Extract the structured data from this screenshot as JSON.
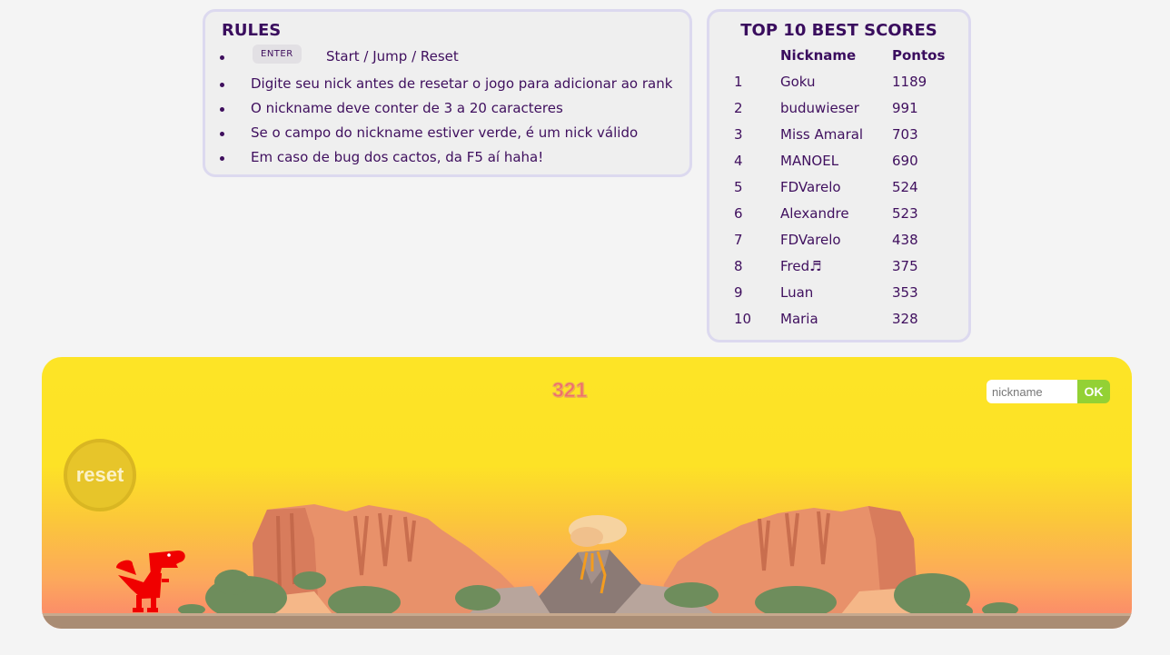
{
  "rules": {
    "title": "RULES",
    "enter_key": "ENTER",
    "items": [
      "Start / Jump / Reset",
      "Digite seu nick antes de resetar o jogo para adicionar ao rank",
      "O nickname deve conter de 3 a 20 caracteres",
      "Se o campo do nickname estiver verde, é um nick válido",
      "Em caso de bug dos cactos, da F5 aí haha!"
    ]
  },
  "scores": {
    "title": "TOP 10 BEST SCORES",
    "col_nickname": "Nickname",
    "col_points": "Pontos",
    "rows": [
      {
        "rank": "1",
        "nick": "Goku",
        "points": "1189"
      },
      {
        "rank": "2",
        "nick": "buduwieser",
        "points": "991"
      },
      {
        "rank": "3",
        "nick": "Miss Amaral",
        "points": "703"
      },
      {
        "rank": "4",
        "nick": "MANOEL",
        "points": "690"
      },
      {
        "rank": "5",
        "nick": "FDVarelo",
        "points": "524"
      },
      {
        "rank": "6",
        "nick": "Alexandre",
        "points": "523"
      },
      {
        "rank": "7",
        "nick": "FDVarelo",
        "points": "438"
      },
      {
        "rank": "8",
        "nick": "Fred♬",
        "points": "375"
      },
      {
        "rank": "9",
        "nick": "Luan",
        "points": "353"
      },
      {
        "rank": "10",
        "nick": "Maria",
        "points": "328"
      }
    ]
  },
  "game": {
    "score": "321",
    "nickname_placeholder": "nickname",
    "nickname_value": "",
    "ok_label": "OK",
    "reset_label": "reset",
    "dino_color": "#f00000",
    "sky_color": "#fde226",
    "ok_color": "#93d134"
  }
}
